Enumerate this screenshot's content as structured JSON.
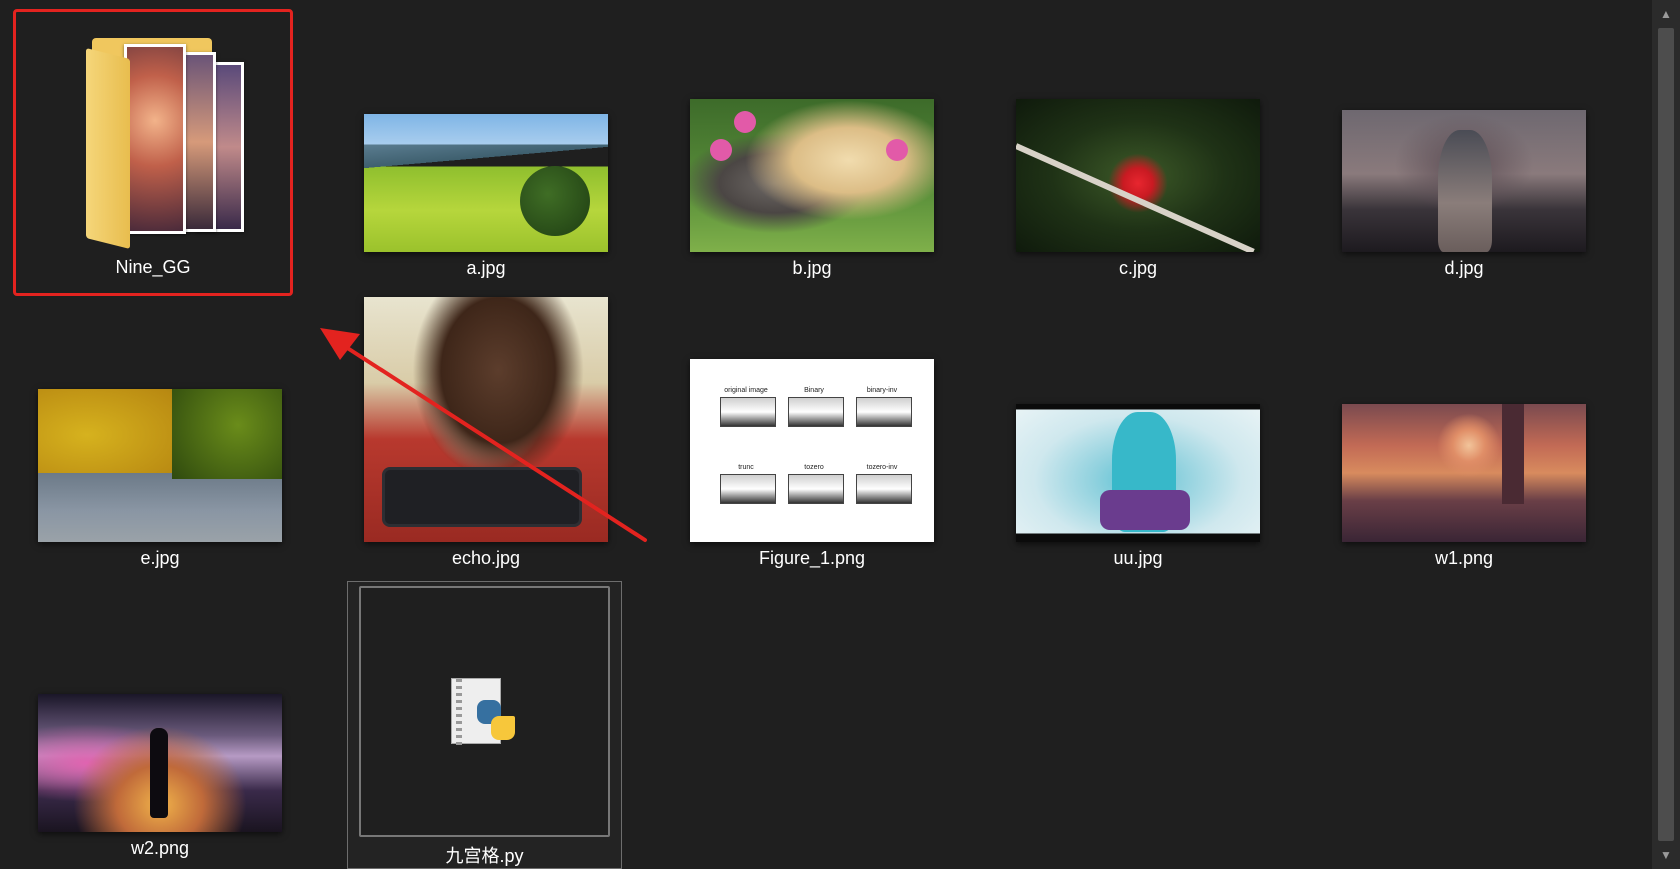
{
  "files": {
    "folder": {
      "name": "Nine_GG"
    },
    "a": "a.jpg",
    "b": "b.jpg",
    "c": "c.jpg",
    "d": "d.jpg",
    "e": "e.jpg",
    "echo": "echo.jpg",
    "figure": "Figure_1.png",
    "uu": "uu.jpg",
    "w1": "w1.png",
    "w2": "w2.png",
    "py": "九宫格.py"
  },
  "figure_panels": [
    "original image",
    "Binary",
    "binary-inv",
    "trunc",
    "tozero",
    "tozero-inv"
  ],
  "icons": {
    "up": "chevron-up-icon",
    "down": "chevron-down-icon",
    "python": "python-file-icon"
  },
  "colors": {
    "background": "#1f1f1f",
    "highlight": "#e3231f",
    "text": "#ffffff"
  }
}
